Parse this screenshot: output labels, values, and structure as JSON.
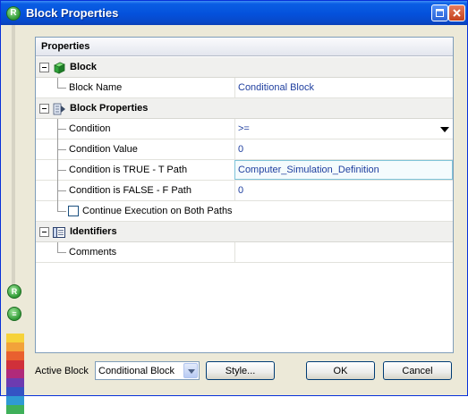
{
  "window": {
    "title": "Block Properties",
    "icon": "app-logo-icon"
  },
  "panel": {
    "header": "Properties"
  },
  "categories": {
    "block": {
      "label": "Block",
      "icon": "cube-icon"
    },
    "block_properties": {
      "label": "Block Properties",
      "icon": "properties-icon"
    },
    "identifiers": {
      "label": "Identifiers",
      "icon": "identifiers-icon"
    }
  },
  "properties": {
    "block_name": {
      "label": "Block Name",
      "value": "Conditional Block"
    },
    "condition": {
      "label": "Condition",
      "value": ">="
    },
    "condition_value": {
      "label": "Condition Value",
      "value": "0"
    },
    "true_path": {
      "label": "Condition is TRUE - T Path",
      "value": "Computer_Simulation_Definition"
    },
    "false_path": {
      "label": "Condition is FALSE - F Path",
      "value": "0"
    },
    "continue_both": {
      "label": "Continue Execution on Both Paths",
      "checked": false
    },
    "comments": {
      "label": "Comments",
      "value": ""
    }
  },
  "footer": {
    "active_block_label": "Active Block",
    "active_block_value": "Conditional Block",
    "style_button": "Style...",
    "ok_button": "OK",
    "cancel_button": "Cancel"
  },
  "colors": {
    "titlebar": "#0451db",
    "value_text": "#1f3f9f",
    "accent": "#7fc4d9"
  }
}
